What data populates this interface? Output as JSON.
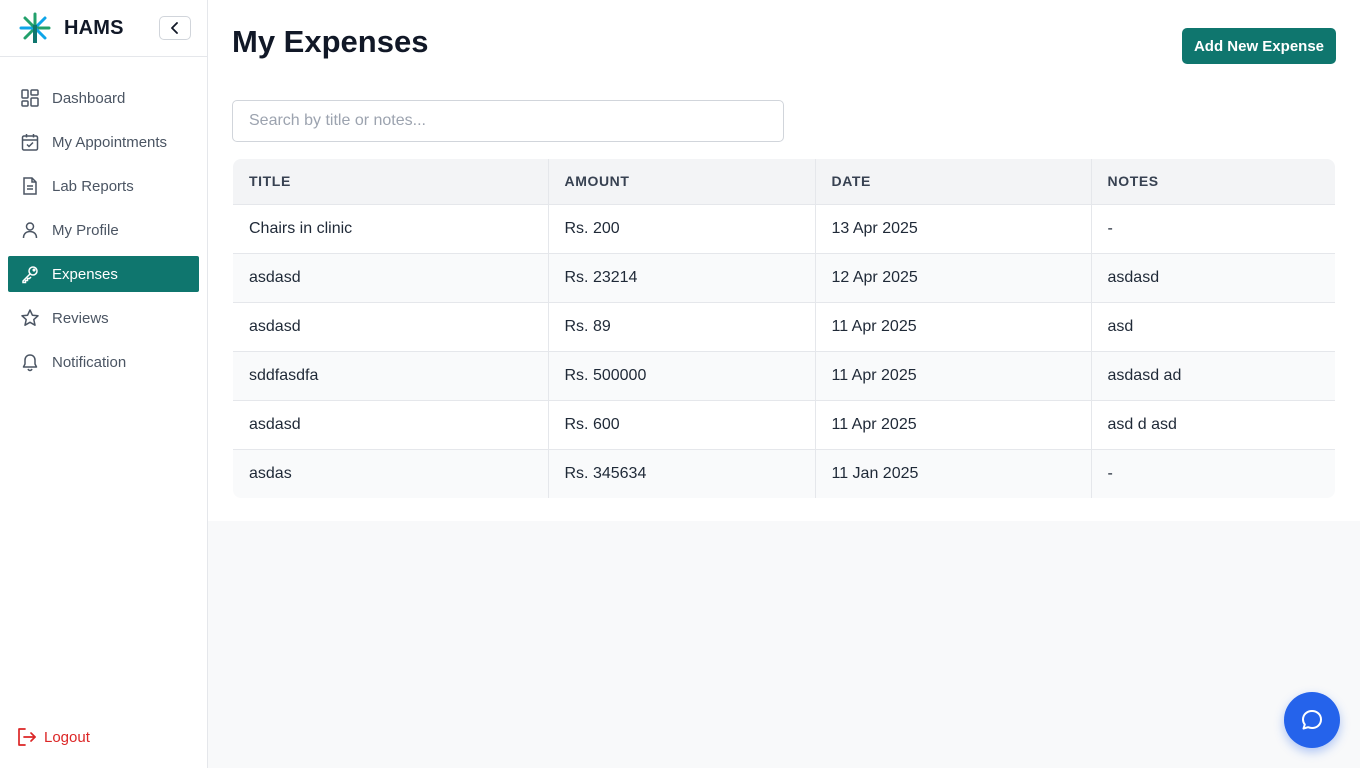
{
  "app": {
    "name": "HAMS"
  },
  "sidebar": {
    "items": [
      {
        "label": "Dashboard",
        "icon": "dashboard-icon",
        "active": false
      },
      {
        "label": "My Appointments",
        "icon": "calendar-check-icon",
        "active": false
      },
      {
        "label": "Lab Reports",
        "icon": "document-icon",
        "active": false
      },
      {
        "label": "My Profile",
        "icon": "user-icon",
        "active": false
      },
      {
        "label": "Expenses",
        "icon": "key-icon",
        "active": true
      },
      {
        "label": "Reviews",
        "icon": "star-icon",
        "active": false
      },
      {
        "label": "Notification",
        "icon": "bell-icon",
        "active": false
      }
    ],
    "logout_label": "Logout"
  },
  "page": {
    "title": "My Expenses",
    "add_button_label": "Add New Expense",
    "search_placeholder": "Search by title or notes...",
    "search_value": ""
  },
  "table": {
    "headers": [
      "TITLE",
      "AMOUNT",
      "DATE",
      "NOTES"
    ],
    "rows": [
      [
        "Chairs in clinic",
        "Rs. 200",
        "13 Apr 2025",
        "-"
      ],
      [
        "asdasd",
        "Rs. 23214",
        "12 Apr 2025",
        "asdasd"
      ],
      [
        "asdasd",
        "Rs. 89",
        "11 Apr 2025",
        "asd"
      ],
      [
        "sddfasdfa",
        "Rs. 500000",
        "11 Apr 2025",
        "asdasd ad"
      ],
      [
        "asdasd",
        "Rs. 600",
        "11 Apr 2025",
        "asd d asd"
      ],
      [
        "asdas",
        "Rs. 345634",
        "11 Jan 2025",
        "-"
      ]
    ]
  },
  "colors": {
    "accent": "#0f766e",
    "logout": "#dc2626",
    "chat": "#2563eb"
  },
  "chat": {
    "icon": "chat-bubble-icon"
  }
}
